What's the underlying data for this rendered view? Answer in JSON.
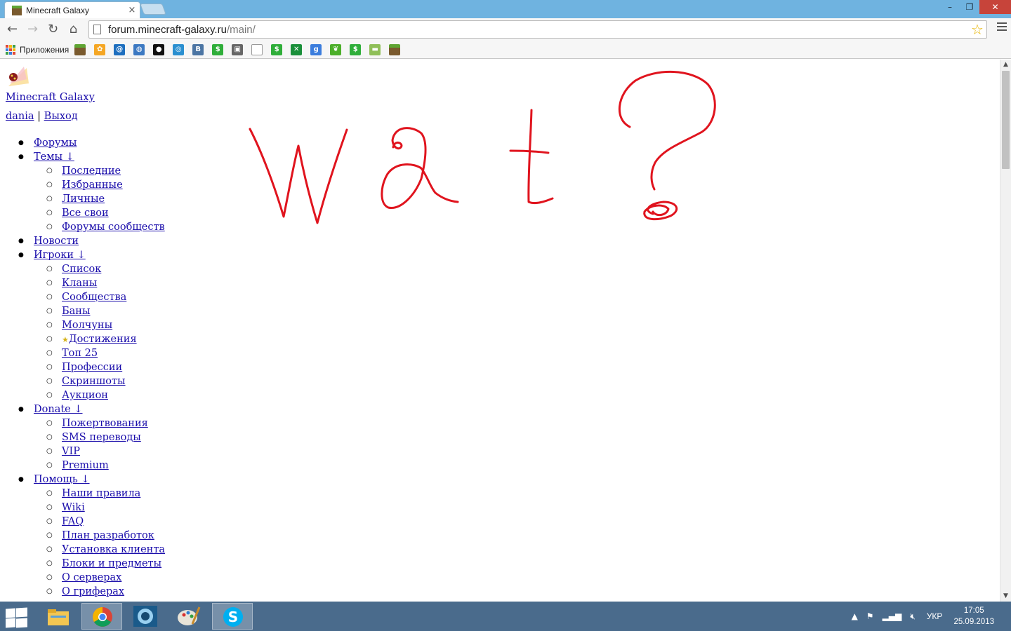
{
  "browser": {
    "tab_title": "Minecraft Galaxy",
    "tab_close": "×",
    "url_host": "forum.minecraft-galaxy.ru",
    "url_path": "/main/",
    "bookmarks_apps_label": "Приложения",
    "bookmarks": [
      {
        "icon": "minecraft-block-icon",
        "color": "#7a5a2e",
        "glyph": ""
      },
      {
        "icon": "flower-icon",
        "color": "#f5a623",
        "glyph": "✿"
      },
      {
        "icon": "mail-at-icon",
        "color": "#1e6fbf",
        "glyph": "@"
      },
      {
        "icon": "globe-icon",
        "color": "#3c79c2",
        "glyph": "◍"
      },
      {
        "icon": "disc-icon",
        "color": "#111111",
        "glyph": "●"
      },
      {
        "icon": "target-icon",
        "color": "#2a8fd0",
        "glyph": "◎"
      },
      {
        "icon": "vk-icon",
        "color": "#4c75a3",
        "glyph": "B"
      },
      {
        "icon": "dollar-icon",
        "color": "#2fae3a",
        "glyph": "$"
      },
      {
        "icon": "gift-icon",
        "color": "#666666",
        "glyph": "▣"
      },
      {
        "icon": "blank-page-icon",
        "color": "#ffffff",
        "glyph": ""
      },
      {
        "icon": "dollar-icon",
        "color": "#2fae3a",
        "glyph": "$"
      },
      {
        "icon": "x-icon",
        "color": "#1a8f3a",
        "glyph": "✕"
      },
      {
        "icon": "google-icon",
        "color": "#3b7ddd",
        "glyph": "g"
      },
      {
        "icon": "leaf-icon",
        "color": "#4caf2a",
        "glyph": "❦"
      },
      {
        "icon": "dollar-icon",
        "color": "#2fae3a",
        "glyph": "$"
      },
      {
        "icon": "landscape-icon",
        "color": "#8fbf58",
        "glyph": "▬"
      },
      {
        "icon": "minecraft-block-icon",
        "color": "#7a5a2e",
        "glyph": ""
      }
    ]
  },
  "site": {
    "title": "Minecraft Galaxy",
    "user": "dania",
    "separator": "|",
    "logout": "Выход",
    "menu": [
      {
        "label": "Форумы",
        "level": 1
      },
      {
        "label": "Темы ↓",
        "level": 1
      },
      {
        "label": "Последние",
        "level": 2
      },
      {
        "label": "Избранные",
        "level": 2
      },
      {
        "label": "Личные",
        "level": 2
      },
      {
        "label": "Все свои",
        "level": 2
      },
      {
        "label": "Форумы сообществ",
        "level": 2
      },
      {
        "label": "Новости",
        "level": 1
      },
      {
        "label": "Игроки ↓",
        "level": 1
      },
      {
        "label": "Список",
        "level": 2
      },
      {
        "label": "Кланы",
        "level": 2
      },
      {
        "label": "Сообщества",
        "level": 2
      },
      {
        "label": "Баны",
        "level": 2
      },
      {
        "label": "Молчуны",
        "level": 2
      },
      {
        "label": "Достижения",
        "level": 2,
        "icon": "star-icon"
      },
      {
        "label": "Топ 25",
        "level": 2
      },
      {
        "label": "Профессии",
        "level": 2
      },
      {
        "label": "Скриншоты",
        "level": 2
      },
      {
        "label": "Аукцион",
        "level": 2
      },
      {
        "label": "Donate ↓",
        "level": 1
      },
      {
        "label": "Пожертвования",
        "level": 2
      },
      {
        "label": "SMS переводы",
        "level": 2
      },
      {
        "label": "VIP",
        "level": 2
      },
      {
        "label": "Premium",
        "level": 2
      },
      {
        "label": "Помощь ↓",
        "level": 1
      },
      {
        "label": "Наши правила",
        "level": 2
      },
      {
        "label": "Wiki",
        "level": 2
      },
      {
        "label": "FAQ",
        "level": 2
      },
      {
        "label": "План разработок",
        "level": 2
      },
      {
        "label": "Установка клиента",
        "level": 2
      },
      {
        "label": "Блоки и предметы",
        "level": 2
      },
      {
        "label": "О серверах",
        "level": 2
      },
      {
        "label": "О гриферах",
        "level": 2
      }
    ],
    "drawing_color": "#e0141e"
  },
  "taskbar": {
    "apps": [
      {
        "name": "start-button-icon"
      },
      {
        "name": "file-explorer-icon"
      },
      {
        "name": "chrome-icon",
        "active": true
      },
      {
        "name": "media-player-icon"
      },
      {
        "name": "paint-icon"
      },
      {
        "name": "skype-icon",
        "active": true
      }
    ],
    "language": "УКР",
    "time": "17:05",
    "date": "25.09.2013"
  }
}
